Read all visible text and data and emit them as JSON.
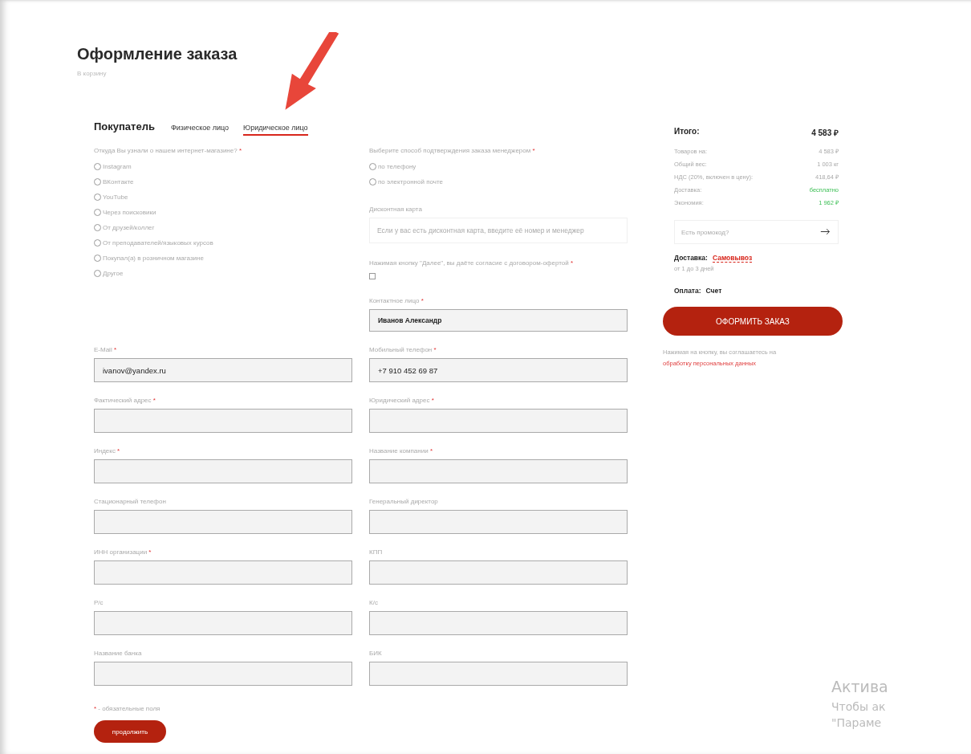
{
  "title": "Оформление заказа",
  "back_link": "В корзину",
  "required_mark": "*",
  "buyer": {
    "heading": "Покупатель",
    "tabs": [
      {
        "label": "Физическое лицо",
        "selected": false
      },
      {
        "label": "Юридическое лицо",
        "selected": true
      }
    ]
  },
  "source_question": {
    "label": "Откуда Вы узнали о нашем интернет-магазине?",
    "required": true,
    "options": [
      {
        "label": "Instagram",
        "selected": false
      },
      {
        "label": "ВКонтакте",
        "selected": false
      },
      {
        "label": "YouTube",
        "selected": false
      },
      {
        "label": "Через поисковики",
        "selected": false
      },
      {
        "label": "От друзей/коллег",
        "selected": false
      },
      {
        "label": "От преподавателей/языковых курсов",
        "selected": false
      },
      {
        "label": "Покупал(а) в розничном магазине",
        "selected": false
      },
      {
        "label": "Другое",
        "selected": false
      }
    ]
  },
  "confirm_question": {
    "label": "Выберите способ подтверждения заказа менеджером",
    "required": true,
    "options": [
      {
        "label": "по телефону",
        "selected": false
      },
      {
        "label": "по электронной почте",
        "selected": false
      }
    ]
  },
  "discount_card": {
    "label": "Дисконтная карта",
    "placeholder": "Если у вас есть дисконтная карта, введите её номер и менеджер"
  },
  "consent": {
    "label": "Нажимая кнопку \"Далее\", вы даёте согласие с договором-офертой",
    "required": true,
    "checked": false
  },
  "contact": {
    "label": "Контактное лицо",
    "required": true,
    "value": "Иванов Александр"
  },
  "fields": [
    {
      "label": "E-Mail",
      "required": true,
      "value": "ivanov@yandex.ru"
    },
    {
      "label": "Мобильный телефон",
      "required": true,
      "value": "+7 910 452 69 87"
    },
    {
      "label": "Фактический адрес",
      "required": true
    },
    {
      "label": "Юридический адрес",
      "required": true
    },
    {
      "label": "Индекс",
      "required": true
    },
    {
      "label": "Название компании",
      "required": true
    },
    {
      "label": "Стационарный телефон",
      "required": false
    },
    {
      "label": "Генеральный директор",
      "required": false
    },
    {
      "label": "ИНН организации",
      "required": true
    },
    {
      "label": "КПП",
      "required": false
    },
    {
      "label": "Р/с",
      "required": false
    },
    {
      "label": "К/с",
      "required": false
    },
    {
      "label": "Название банка",
      "required": false
    },
    {
      "label": "БИК",
      "required": false
    }
  ],
  "required_note": "- обязательные поля",
  "continue_button": "продолжить",
  "summary": {
    "total_label": "Итого:",
    "total_value": "4 583 ₽",
    "rows": [
      {
        "label": "Товаров на:",
        "value": "4 583 ₽",
        "highlight": false
      },
      {
        "label": "Общий вес:",
        "value": "1 003 кг",
        "highlight": false
      },
      {
        "label": "НДС (20%, включен в цену):",
        "value": "418,64 ₽",
        "highlight": false
      },
      {
        "label": "Доставка:",
        "value": "бесплатно",
        "highlight": true
      },
      {
        "label": "Экономия:",
        "value": "1 962 ₽",
        "highlight": true
      }
    ],
    "promo_placeholder": "Есть промокод?",
    "delivery_label": "Доставка:",
    "delivery_value": "Самовывоз",
    "delivery_time": "от 1 до 3 дней",
    "payment_label": "Оплата:",
    "payment_value": "Счет",
    "order_button": "ОФОРМИТЬ ЗАКАЗ",
    "agreement_text": "Нажимая на кнопку, вы соглашаетесь на",
    "agreement_link": "обработку персональных данных"
  },
  "os_notice": [
    "Актива",
    "Чтобы ак",
    "\"Параме"
  ]
}
